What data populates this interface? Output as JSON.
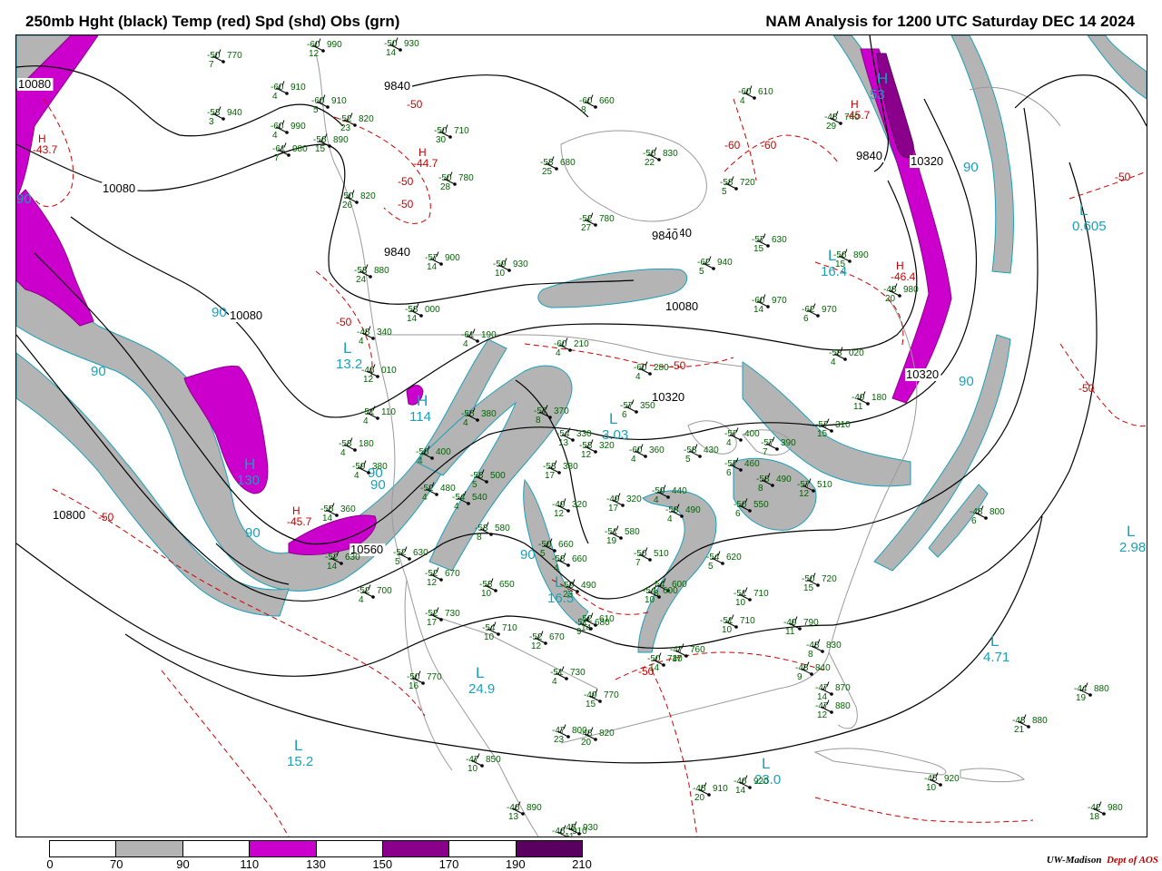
{
  "header": {
    "title_left": "250mb Hght (black) Temp (red) Spd (shd) Obs (grn)",
    "title_right": "NAM Analysis for 1200 UTC Saturday  DEC 14 2024"
  },
  "legend": {
    "ticks": [
      "0",
      "70",
      "90",
      "110",
      "130",
      "150",
      "170",
      "190",
      "210"
    ],
    "colors": [
      "#ffffff",
      "#b4b4b4",
      "#ffffff",
      "#cc00cc",
      "#ffffff",
      "#8a008a",
      "#ffffff",
      "#5a0060"
    ]
  },
  "credit": {
    "org": "UW-Madison",
    "dept": "Dept of AOS"
  },
  "colors": {
    "height": "#000000",
    "temperature": "#cc0000",
    "obs": "#006400",
    "centers": "#1aa0b8",
    "shade_70": "#b4b4b4",
    "shade_110": "#cc00cc",
    "shade_150": "#8a008a",
    "geography": "#9a9a9a"
  },
  "height_labels": [
    "10080",
    "10080",
    "9840",
    "9840",
    "10080",
    "9840",
    "10080",
    "10320",
    "10320",
    "10800",
    "10560",
    "9840",
    "10320",
    "9840"
  ],
  "temp_labels": [
    "-50",
    "-50",
    "-50",
    "-50",
    "-50",
    "-50",
    "-50",
    "-60",
    "-60",
    "-50",
    "-50"
  ],
  "centers": [
    {
      "type": "H",
      "value": "-43.7",
      "kind": "temp"
    },
    {
      "type": "H",
      "value": "-44.7",
      "kind": "temp"
    },
    {
      "type": "H",
      "value": "-45.7",
      "kind": "temp"
    },
    {
      "type": "H",
      "value": "-46.4",
      "kind": "temp"
    },
    {
      "type": "H",
      "value": "-45.7",
      "kind": "temp"
    },
    {
      "type": "L",
      "value": "13.2",
      "kind": "speed"
    },
    {
      "type": "H",
      "value": "130",
      "kind": "speed"
    },
    {
      "type": "H",
      "value": "114",
      "kind": "speed"
    },
    {
      "type": "L",
      "value": "0.605",
      "kind": "speed"
    },
    {
      "type": "L",
      "value": "16.4",
      "kind": "speed"
    },
    {
      "type": "L",
      "value": "2.98",
      "kind": "speed"
    },
    {
      "type": "L",
      "value": "4.71",
      "kind": "speed"
    },
    {
      "type": "L",
      "value": "24.9",
      "kind": "speed"
    },
    {
      "type": "L",
      "value": "15.2",
      "kind": "speed"
    },
    {
      "type": "L",
      "value": "23.0",
      "kind": "speed"
    },
    {
      "type": "L",
      "value": "16.5",
      "kind": "speed"
    },
    {
      "type": "L",
      "value": "3.03",
      "kind": "speed"
    },
    {
      "type": "H",
      "value": "53",
      "kind": "speed"
    }
  ],
  "speed_labels": [
    "90",
    "90",
    "90",
    "90",
    "90",
    "90",
    "90",
    "90",
    "90"
  ],
  "observations": [
    {
      "t": "-50",
      "h": "770",
      "d": "7"
    },
    {
      "t": "-53",
      "h": "940",
      "d": "3"
    },
    {
      "t": "-60",
      "h": "910",
      "d": "4"
    },
    {
      "t": "-60",
      "h": "990",
      "d": "4"
    },
    {
      "t": "-61",
      "h": "980",
      "d": "7"
    },
    {
      "t": "-60",
      "h": "990",
      "d": "12"
    },
    {
      "t": "-50",
      "h": "930",
      "d": "14"
    },
    {
      "t": "-60",
      "h": "910",
      "d": "5"
    },
    {
      "t": "-56",
      "h": "890",
      "d": "15"
    },
    {
      "t": "-52",
      "h": "820",
      "d": "23"
    },
    {
      "t": "-50",
      "h": "710",
      "d": "30"
    },
    {
      "t": "-60",
      "h": "660",
      "d": "8"
    },
    {
      "t": "-60",
      "h": "610",
      "d": "4"
    },
    {
      "t": "-48",
      "h": "740",
      "d": "29"
    },
    {
      "t": "-53",
      "h": "680",
      "d": "25"
    },
    {
      "t": "-50",
      "h": "780",
      "d": "28"
    },
    {
      "t": "-56",
      "h": "830",
      "d": "22"
    },
    {
      "t": "-58",
      "h": "720",
      "d": "5"
    },
    {
      "t": "-50",
      "h": "820",
      "d": "26"
    },
    {
      "t": "-52",
      "h": "780",
      "d": "27"
    },
    {
      "t": "-57",
      "h": "630",
      "d": "15"
    },
    {
      "t": "-56",
      "h": "890",
      "d": "15"
    },
    {
      "t": "-57",
      "h": "900",
      "d": "14"
    },
    {
      "t": "-59",
      "h": "930",
      "d": "10"
    },
    {
      "t": "-62",
      "h": "940",
      "d": "5"
    },
    {
      "t": "-53",
      "h": "880",
      "d": "24"
    },
    {
      "t": "-60",
      "h": "970",
      "d": "14"
    },
    {
      "t": "-62",
      "h": "970",
      "d": "6"
    },
    {
      "t": "-48",
      "h": "980",
      "d": "20"
    },
    {
      "t": "-58",
      "h": "000",
      "d": "14"
    },
    {
      "t": "-48",
      "h": "340",
      "d": "4"
    },
    {
      "t": "-61",
      "h": "190",
      "d": "4"
    },
    {
      "t": "-60",
      "h": "210",
      "d": "4"
    },
    {
      "t": "-60",
      "h": "280",
      "d": "4"
    },
    {
      "t": "-58",
      "h": "020",
      "d": "4"
    },
    {
      "t": "-46",
      "h": "010",
      "d": "12"
    },
    {
      "t": "-51",
      "h": "110",
      "d": "4"
    },
    {
      "t": "-55",
      "h": "380",
      "d": "4"
    },
    {
      "t": "-57",
      "h": "370",
      "d": "8"
    },
    {
      "t": "-57",
      "h": "350",
      "d": "6"
    },
    {
      "t": "-49",
      "h": "180",
      "d": "11"
    },
    {
      "t": "-53",
      "h": "180",
      "d": "4"
    },
    {
      "t": "-56",
      "h": "400",
      "d": "4"
    },
    {
      "t": "-54",
      "h": "330",
      "d": "13"
    },
    {
      "t": "-53",
      "h": "320",
      "d": "12"
    },
    {
      "t": "-58",
      "h": "430",
      "d": "5"
    },
    {
      "t": "-60",
      "h": "360",
      "d": "4"
    },
    {
      "t": "-57",
      "h": "400",
      "d": "4"
    },
    {
      "t": "-57",
      "h": "390",
      "d": "7"
    },
    {
      "t": "-57",
      "h": "310",
      "d": "15"
    },
    {
      "t": "-53",
      "h": "500",
      "d": "5"
    },
    {
      "t": "-53",
      "h": "380",
      "d": "17"
    },
    {
      "t": "-57",
      "h": "460",
      "d": "6"
    },
    {
      "t": "-58",
      "h": "490",
      "d": "8"
    },
    {
      "t": "-57",
      "h": "510",
      "d": "12"
    },
    {
      "t": "-59",
      "h": "380",
      "d": "4"
    },
    {
      "t": "-52",
      "h": "480",
      "d": "4"
    },
    {
      "t": "-54",
      "h": "540",
      "d": "4"
    },
    {
      "t": "-59",
      "h": "440",
      "d": "4"
    },
    {
      "t": "-49",
      "h": "320",
      "d": "12"
    },
    {
      "t": "-49",
      "h": "320",
      "d": "17"
    },
    {
      "t": "-58",
      "h": "490",
      "d": "4"
    },
    {
      "t": "-56",
      "h": "550",
      "d": "6"
    },
    {
      "t": "-55",
      "h": "360",
      "d": "14"
    },
    {
      "t": "-53",
      "h": "580",
      "d": "8"
    },
    {
      "t": "-51",
      "h": "580",
      "d": "19"
    },
    {
      "t": "-54",
      "h": "600",
      "d": "8"
    },
    {
      "t": "-58",
      "h": "660",
      "d": "4"
    },
    {
      "t": "-52",
      "h": "630",
      "d": "5"
    },
    {
      "t": "-50",
      "h": "660",
      "d": "5"
    },
    {
      "t": "-52",
      "h": "630",
      "d": "14"
    },
    {
      "t": "-56",
      "h": "510",
      "d": "7"
    },
    {
      "t": "-54",
      "h": "620",
      "d": "5"
    },
    {
      "t": "-52",
      "h": "670",
      "d": "12"
    },
    {
      "t": "-53",
      "h": "650",
      "d": "10"
    },
    {
      "t": "-59",
      "h": "490",
      "d": "23"
    },
    {
      "t": "-54",
      "h": "600",
      "d": "10"
    },
    {
      "t": "-50",
      "h": "720",
      "d": "15"
    },
    {
      "t": "-51",
      "h": "710",
      "d": "10"
    },
    {
      "t": "-52",
      "h": "700",
      "d": "4"
    },
    {
      "t": "-52",
      "h": "730",
      "d": "17"
    },
    {
      "t": "-54",
      "h": "710",
      "d": "10"
    },
    {
      "t": "-52",
      "h": "670",
      "d": "12"
    },
    {
      "t": "-52",
      "h": "610",
      "d": "14"
    },
    {
      "t": "-51",
      "h": "680",
      "d": "9"
    },
    {
      "t": "-51",
      "h": "710",
      "d": "10"
    },
    {
      "t": "-49",
      "h": "790",
      "d": "11"
    },
    {
      "t": "-48",
      "h": "830",
      "d": "8"
    },
    {
      "t": "-50",
      "h": "740",
      "d": "14"
    },
    {
      "t": "-47",
      "h": "760",
      "d": "17"
    },
    {
      "t": "-48",
      "h": "840",
      "d": "9"
    },
    {
      "t": "-47",
      "h": "870",
      "d": "14"
    },
    {
      "t": "-47",
      "h": "880",
      "d": "12"
    },
    {
      "t": "-50",
      "h": "770",
      "d": "16"
    },
    {
      "t": "-51",
      "h": "730",
      "d": "4"
    },
    {
      "t": "-49",
      "h": "770",
      "d": "15"
    },
    {
      "t": "-47",
      "h": "800",
      "d": "23"
    },
    {
      "t": "-48",
      "h": "820",
      "d": "20"
    },
    {
      "t": "-47",
      "h": "850",
      "d": "10"
    },
    {
      "t": "-46",
      "h": "890",
      "d": "13"
    },
    {
      "t": "-46",
      "h": "910",
      "d": "11"
    },
    {
      "t": "-45",
      "h": "930",
      "d": "11"
    },
    {
      "t": "-45",
      "h": "910",
      "d": "20"
    },
    {
      "t": "-46",
      "h": "920",
      "d": "14"
    },
    {
      "t": "-45",
      "h": "920",
      "d": "10"
    },
    {
      "t": "-48",
      "h": "800",
      "d": "6"
    },
    {
      "t": "-44",
      "h": "880",
      "d": "19"
    },
    {
      "t": "-43",
      "h": "880",
      "d": "21"
    },
    {
      "t": "-42",
      "h": "980",
      "d": "18"
    }
  ]
}
